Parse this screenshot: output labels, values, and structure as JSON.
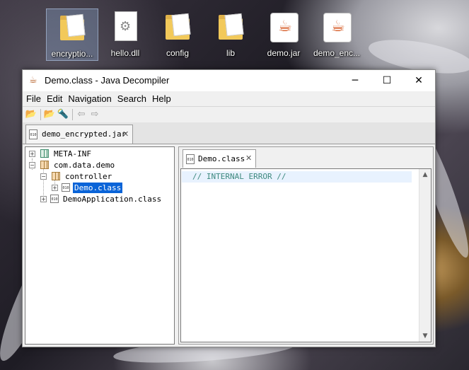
{
  "desktop": {
    "icons": [
      {
        "label": "encryptio...",
        "type": "folder"
      },
      {
        "label": "hello.dll",
        "type": "file"
      },
      {
        "label": "config",
        "type": "folder"
      },
      {
        "label": "lib",
        "type": "folder"
      },
      {
        "label": "demo.jar",
        "type": "jar"
      },
      {
        "label": "demo_enc...",
        "type": "jar"
      }
    ]
  },
  "window": {
    "title": "Demo.class - Java Decompiler",
    "controls": {
      "minimize": "─",
      "maximize": "☐",
      "close": "✕"
    },
    "menu": [
      "File",
      "Edit",
      "Navigation",
      "Search",
      "Help"
    ],
    "toolbar_icons": [
      "open-file-icon",
      "open-type-icon",
      "search-icon",
      "back-icon",
      "forward-icon"
    ],
    "file_tab": {
      "label": "demo_encrypted.jar",
      "icon_text": "010",
      "close": "✕"
    },
    "tree": {
      "nodes": [
        {
          "label": "META-INF",
          "expander": "+"
        },
        {
          "label": "com.data.demo",
          "expander": "−"
        },
        {
          "label": "controller",
          "expander": "−"
        },
        {
          "label": "Demo.class",
          "expander": "+",
          "selected": true,
          "icon_text": "010"
        },
        {
          "label": "DemoApplication.class",
          "expander": "+",
          "icon_text": "010"
        }
      ]
    },
    "editor": {
      "tab": {
        "label": "Demo.class",
        "icon_text": "010",
        "close": "✕"
      },
      "code": "// INTERNAL ERROR //",
      "scroll_up": "▲",
      "scroll_down": "▼"
    }
  },
  "colors": {
    "selection": "#0a64d8",
    "comment": "#3f8a7f",
    "current_line": "#e8f2fe"
  }
}
